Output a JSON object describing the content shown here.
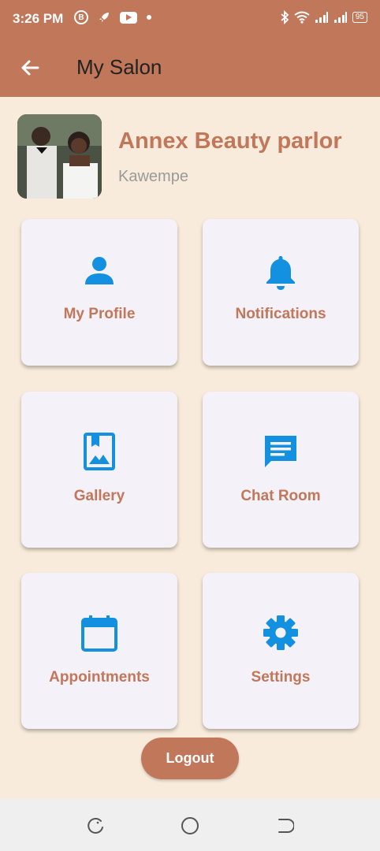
{
  "status_bar": {
    "time": "3:26 PM",
    "icons_left": [
      "b-icon",
      "rocket-icon",
      "youtube-icon",
      "dot-icon"
    ],
    "icons_right": [
      "bluetooth-icon",
      "wifi-icon",
      "signal-icon",
      "signal-icon"
    ],
    "battery": "95"
  },
  "app_bar": {
    "title": "My Salon",
    "back_icon": "arrow-back-icon"
  },
  "salon": {
    "name": "Annex Beauty parlor",
    "location": "Kawempe"
  },
  "menu": [
    {
      "label": "My Profile",
      "icon": "person-icon"
    },
    {
      "label": "Notifications",
      "icon": "bell-icon"
    },
    {
      "label": "Gallery",
      "icon": "photo-album-icon"
    },
    {
      "label": "Chat Room",
      "icon": "chat-icon"
    },
    {
      "label": "Appointments",
      "icon": "calendar-icon"
    },
    {
      "label": "Settings",
      "icon": "gear-icon"
    }
  ],
  "logout_label": "Logout",
  "colors": {
    "primary": "#c1775a",
    "background": "#f8ebdb",
    "card": "#f4f1f8",
    "icon": "#1391e0",
    "subtext": "#9a9a9a"
  },
  "nav_bar": {
    "buttons": [
      "recents-icon",
      "home-icon",
      "back-icon"
    ]
  }
}
